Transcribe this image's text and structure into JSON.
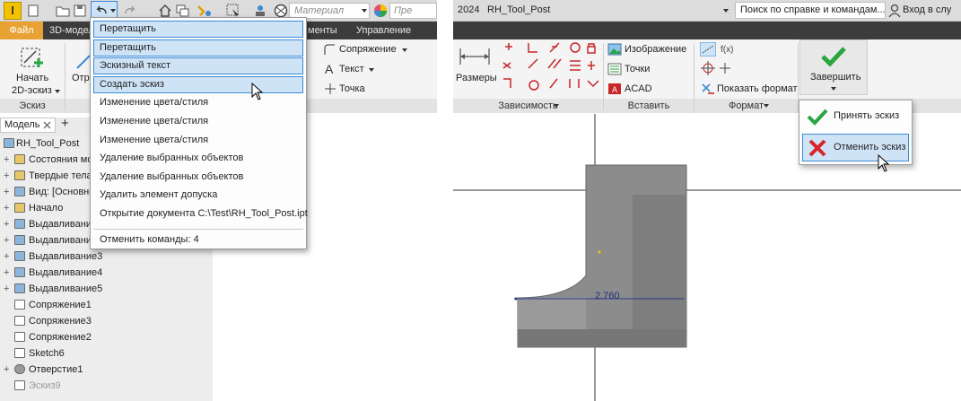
{
  "left_panel": {
    "qat": {
      "app_letter": "I",
      "material_placeholder": "Материал",
      "appearance_placeholder": "Пре"
    },
    "tabs": [
      {
        "label": "Файл"
      },
      {
        "label": "3D-модел"
      },
      {
        "label": "менты"
      },
      {
        "label": "Управление"
      }
    ],
    "ribbon": {
      "start_sketch_line1": "Начать",
      "start_sketch_line2": "2D-эскиз",
      "partial_label": "Отр",
      "fillet_label": "Сопряжение",
      "text_label": "Текст",
      "point_label": "Точка",
      "group_sketch": "Эскиз"
    },
    "browser": {
      "tab_label": "Модель",
      "add_symbol": "+",
      "items": [
        {
          "label": "RH_Tool_Post"
        },
        {
          "label": "Состояния мод"
        },
        {
          "label": "Твердые тела("
        },
        {
          "label": "Вид: [Основной"
        },
        {
          "label": "Начало"
        },
        {
          "label": "Выдавливание"
        },
        {
          "label": "Выдавливание"
        },
        {
          "label": "Выдавливание3"
        },
        {
          "label": "Выдавливание4"
        },
        {
          "label": "Выдавливание5"
        },
        {
          "label": "Сопряжение1"
        },
        {
          "label": "Сопряжение3"
        },
        {
          "label": "Сопряжение2"
        },
        {
          "label": "Sketch6"
        },
        {
          "label": "Отверстие1"
        },
        {
          "label": "Эскиз9"
        }
      ]
    },
    "undo_menu": {
      "items": [
        {
          "label": "Перетащить",
          "selected": true
        },
        {
          "label": "Перетащить",
          "selected": true
        },
        {
          "label": "Эскизный текст",
          "selected": true
        },
        {
          "label": "Создать эскиз",
          "selected": true
        },
        {
          "label": "Изменение цвета/стиля",
          "selected": false
        },
        {
          "label": "Изменение цвета/стиля",
          "selected": false
        },
        {
          "label": "Изменение цвета/стиля",
          "selected": false
        },
        {
          "label": "Удаление выбранных объектов",
          "selected": false
        },
        {
          "label": "Удаление выбранных объектов",
          "selected": false
        },
        {
          "label": "Удалить элемент допуска",
          "selected": false
        },
        {
          "label": "Открытие документа C:\\Test\\RH_Tool_Post.ipt",
          "selected": false
        }
      ],
      "footer": "Отменить команды: 4"
    }
  },
  "right_panel": {
    "title_year": "2024",
    "doc_title": "RH_Tool_Post",
    "search_placeholder": "Поиск по справке и командам...",
    "signin_label": "Вход в слу",
    "ribbon": {
      "dimension_label": "Размеры",
      "group_constraints": "Зависимость",
      "image_label": "Изображение",
      "points_label": "Точки",
      "acad_label": "ACAD",
      "group_insert": "Вставить",
      "show_format_label": "Показать формат",
      "group_format": "Формат",
      "finish_label": "Завершить"
    },
    "finish_menu": {
      "accept": "Принять эскиз",
      "cancel": "Отменить эскиз"
    },
    "dimension_value": "2.760"
  },
  "colors": {
    "file_tab": "#e8a234",
    "app_icon": "#f2c200",
    "menu_highlight": "#cfe3f7",
    "menu_border": "#3d8bd4",
    "check_green": "#2aa640",
    "cross_red": "#d8242a",
    "model_gray": "#8c8c8c"
  }
}
